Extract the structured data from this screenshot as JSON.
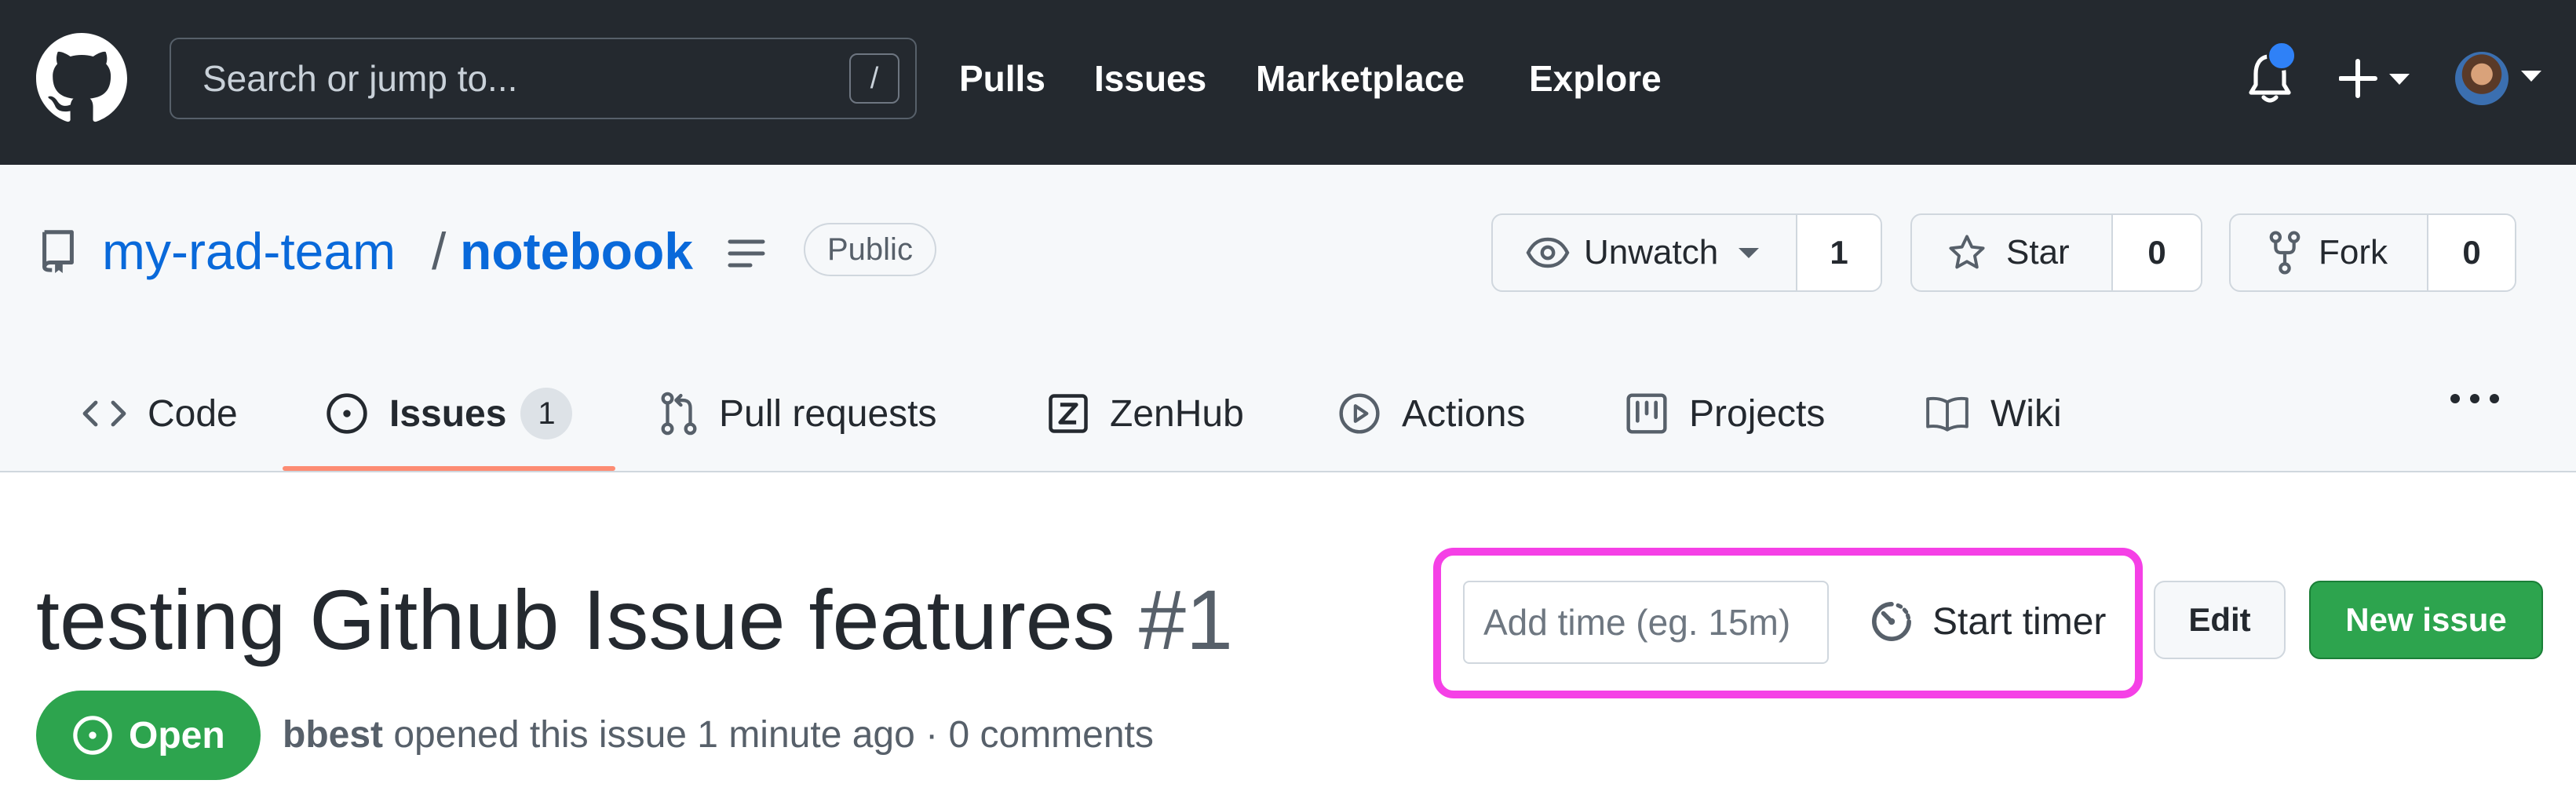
{
  "header": {
    "search_placeholder": "Search or jump to...",
    "search_shortcut": "/",
    "nav": [
      "Pulls",
      "Issues",
      "Marketplace",
      "Explore"
    ],
    "has_notification": true
  },
  "repo": {
    "owner": "my-rad-team",
    "separator": "/",
    "name": "notebook",
    "visibility": "Public",
    "watch": {
      "label": "Unwatch",
      "count": "1"
    },
    "star": {
      "label": "Star",
      "count": "0"
    },
    "fork": {
      "label": "Fork",
      "count": "0"
    },
    "tabs": [
      {
        "label": "Code",
        "icon": "code-icon"
      },
      {
        "label": "Issues",
        "icon": "issue-opened-icon",
        "count": "1",
        "selected": true
      },
      {
        "label": "Pull requests",
        "icon": "git-pull-request-icon"
      },
      {
        "label": "ZenHub",
        "icon": "zenhub-icon"
      },
      {
        "label": "Actions",
        "icon": "play-icon"
      },
      {
        "label": "Projects",
        "icon": "project-icon"
      },
      {
        "label": "Wiki",
        "icon": "book-icon"
      }
    ]
  },
  "issue": {
    "title": "testing Github Issue features",
    "number": "#1",
    "state": "Open",
    "author": "bbest",
    "meta_text": "opened this issue 1 minute ago · 0 comments",
    "time_placeholder": "Add time (eg. 15m)",
    "start_timer_label": "Start timer",
    "edit_label": "Edit",
    "new_issue_label": "New issue"
  },
  "colors": {
    "header_bg": "#24292f",
    "link_blue": "#0969da",
    "open_green": "#2da44e",
    "tab_underline": "#fd8c73",
    "highlight_magenta": "#f540e6",
    "notification_blue": "#2f81f7"
  }
}
